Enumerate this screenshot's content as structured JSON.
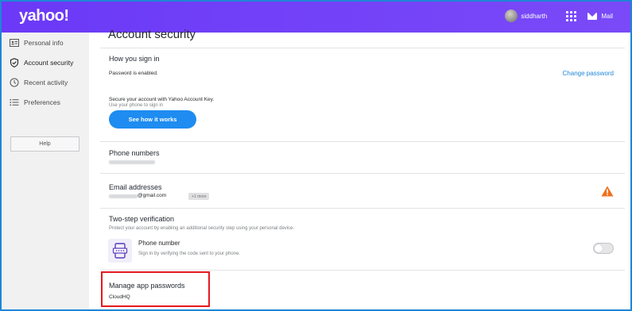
{
  "header": {
    "logo": "yahoo!",
    "user_name": "siddharth",
    "mail_label": "Mail",
    "accent": "#6b39f7"
  },
  "sidebar": {
    "items": [
      {
        "label": "Personal info",
        "icon": "id-card-icon"
      },
      {
        "label": "Account security",
        "icon": "shield-check-icon"
      },
      {
        "label": "Recent activity",
        "icon": "clock-icon"
      },
      {
        "label": "Preferences",
        "icon": "list-icon"
      }
    ],
    "help_label": "Help"
  },
  "main": {
    "page_title": "Account security",
    "sign_in": {
      "title": "How you sign in",
      "status": "Password is enabled.",
      "change_password": "Change password",
      "account_key_title": "Secure your account with Yahoo Account Key.",
      "account_key_sub": "Use your phone to sign in",
      "see_how_button": "See how it works"
    },
    "phone_numbers": {
      "title": "Phone numbers"
    },
    "email_addresses": {
      "title": "Email addresses",
      "email_suffix": "@gmail.com",
      "more_badge": "+1 more",
      "warning_color": "#f0701a"
    },
    "two_step": {
      "title": "Two-step verification",
      "description": "Protect your account by enabling an additional security step using your personal device.",
      "method_title": "Phone number",
      "method_description": "Sign in by verifying the code sent to your phone.",
      "enabled": false
    },
    "app_passwords": {
      "title": "Manage app passwords",
      "app_name": "CloudHQ",
      "highlight_color": "#e5191f"
    }
  }
}
